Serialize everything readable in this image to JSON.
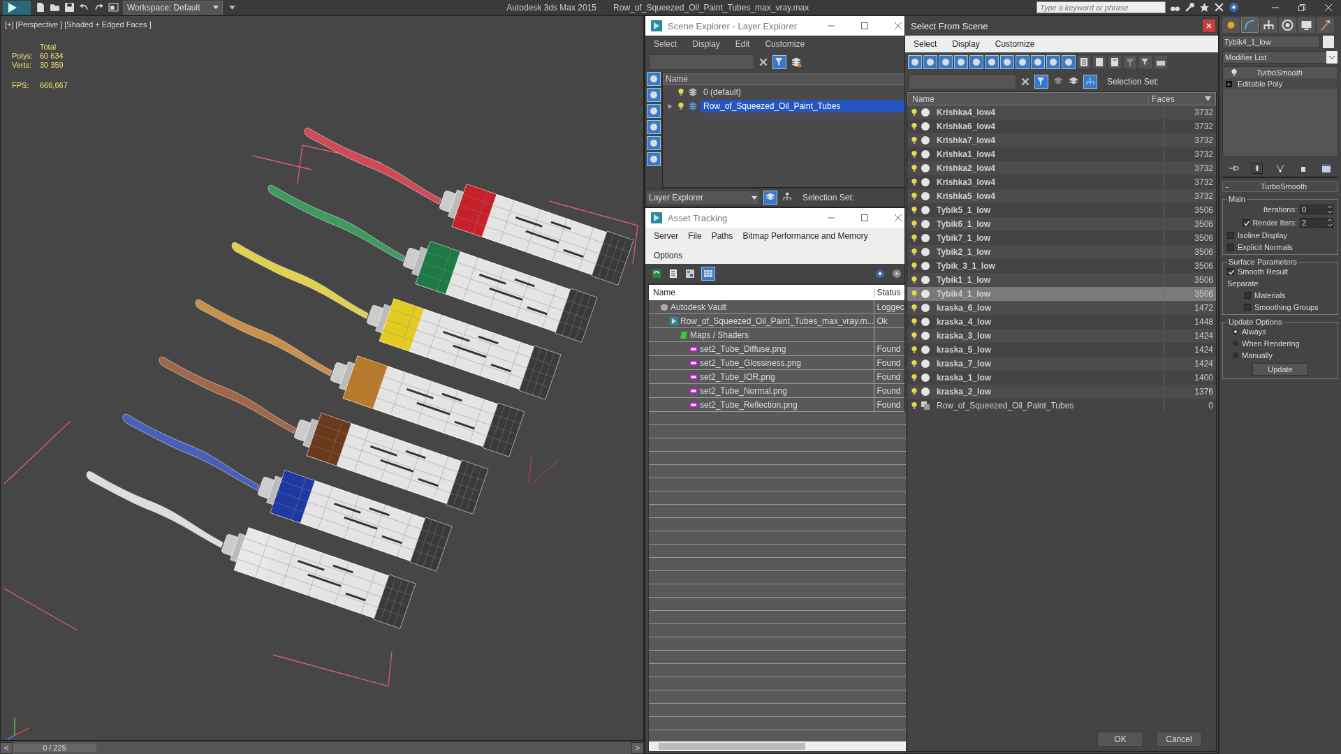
{
  "title_bar": {
    "workspace": "Workspace: Default",
    "app_title": "Autodesk 3ds Max  2015",
    "file_title": "Row_of_Squeezed_Oil_Paint_Tubes_max_vray.max",
    "search_placeholder": "Type a keyword or phrase"
  },
  "viewport": {
    "label": "[+] [Perspective ] [Shaded + Edged Faces ]",
    "stats_header": "Total",
    "stats": [
      {
        "label": "Polys:",
        "value": "60 634"
      },
      {
        "label": "Verts:",
        "value": "30 359"
      }
    ],
    "fps_label": "FPS:",
    "fps": "666,667"
  },
  "timeline": {
    "prev": "<",
    "position": "0 / 225",
    "level": 0,
    "next": ">"
  },
  "scene_explorer": {
    "title": "Scene Explorer - Layer Explorer",
    "menu": [
      "Select",
      "Display",
      "Edit",
      "Customize"
    ],
    "column": "Name",
    "layers": [
      {
        "name": "0 (default)",
        "selected": false,
        "expandable": false
      },
      {
        "name": "Row_of_Squeezed_Oil_Paint_Tubes",
        "selected": true,
        "expandable": true
      }
    ],
    "mode": "Layer Explorer",
    "selection_set_label": "Selection Set:"
  },
  "asset_tracking": {
    "title": "Asset Tracking",
    "menu": [
      "Server",
      "File",
      "Paths",
      "Bitmap Performance and Memory",
      "Options"
    ],
    "columns": [
      "Name",
      "Status"
    ],
    "tree": [
      {
        "kind": "vault",
        "name": "Autodesk Vault",
        "status": "Loggec",
        "children": [
          {
            "kind": "max",
            "name": "Row_of_Squeezed_Oil_Paint_Tubes_max_vray.m...",
            "status": "Ok",
            "children": [
              {
                "kind": "maps",
                "name": "Maps / Shaders",
                "children": [
                  {
                    "kind": "png",
                    "name": "set2_Tube_Diffuse.png",
                    "status": "Found"
                  },
                  {
                    "kind": "png",
                    "name": "set2_Tube_Glossiness.png",
                    "status": "Found"
                  },
                  {
                    "kind": "png",
                    "name": "set2_Tube_IOR.png",
                    "status": "Found"
                  },
                  {
                    "kind": "png",
                    "name": "set2_Tube_Normal.png",
                    "status": "Found"
                  },
                  {
                    "kind": "png",
                    "name": "set2_Tube_Reflection.png",
                    "status": "Found"
                  }
                ]
              }
            ]
          }
        ]
      }
    ]
  },
  "select_from_scene": {
    "title": "Select From Scene",
    "menu": [
      "Select",
      "Display",
      "Customize"
    ],
    "selection_set_label": "Selection Set:",
    "columns": [
      "Name",
      "Faces"
    ],
    "rows": [
      {
        "kind": "geometry",
        "name": "Krishka4_low4",
        "faces": "3732",
        "selected": false
      },
      {
        "kind": "geometry",
        "name": "Krishka6_low4",
        "faces": "3732",
        "selected": false
      },
      {
        "kind": "geometry",
        "name": "Krishka7_low4",
        "faces": "3732",
        "selected": false
      },
      {
        "kind": "geometry",
        "name": "Krishka1_low4",
        "faces": "3732",
        "selected": false
      },
      {
        "kind": "geometry",
        "name": "Krishka2_low4",
        "faces": "3732",
        "selected": false
      },
      {
        "kind": "geometry",
        "name": "Krishka3_low4",
        "faces": "3732",
        "selected": false
      },
      {
        "kind": "geometry",
        "name": "Krishka5_low4",
        "faces": "3732",
        "selected": false
      },
      {
        "kind": "geometry",
        "name": "Tybik5_1_low",
        "faces": "3506",
        "selected": false
      },
      {
        "kind": "geometry",
        "name": "Tybik6_1_low",
        "faces": "3506",
        "selected": false
      },
      {
        "kind": "geometry",
        "name": "Tybik7_1_low",
        "faces": "3506",
        "selected": false
      },
      {
        "kind": "geometry",
        "name": "Tybik2_1_low",
        "faces": "3506",
        "selected": false
      },
      {
        "kind": "geometry",
        "name": "Tybik_3_1_low",
        "faces": "3506",
        "selected": false
      },
      {
        "kind": "geometry",
        "name": "Tybik1_1_low",
        "faces": "3506",
        "selected": false
      },
      {
        "kind": "geometry",
        "name": "Tybik4_1_low",
        "faces": "3506",
        "selected": true
      },
      {
        "kind": "geometry",
        "name": "kraska_6_low",
        "faces": "1472",
        "selected": false
      },
      {
        "kind": "geometry",
        "name": "kraska_4_low",
        "faces": "1448",
        "selected": false
      },
      {
        "kind": "geometry",
        "name": "kraska_3_low",
        "faces": "1424",
        "selected": false
      },
      {
        "kind": "geometry",
        "name": "kraska_5_low",
        "faces": "1424",
        "selected": false
      },
      {
        "kind": "geometry",
        "name": "kraska_7_low",
        "faces": "1424",
        "selected": false
      },
      {
        "kind": "geometry",
        "name": "kraska_1_low",
        "faces": "1400",
        "selected": false
      },
      {
        "kind": "geometry",
        "name": "kraska_2_low",
        "faces": "1376",
        "selected": false
      },
      {
        "kind": "group",
        "name": "Row_of_Squeezed_Oil_Paint_Tubes",
        "faces": "0",
        "selected": false
      }
    ],
    "buttons": [
      "OK",
      "Cancel"
    ]
  },
  "command_panel": {
    "object_name": "Tybik4_1_low",
    "modifier_list": "Modifier List",
    "stack": [
      {
        "kind": "modifier",
        "name": "TurboSmooth"
      },
      {
        "kind": "base",
        "name": "Editable Poly"
      }
    ],
    "rollout": {
      "collapse": "-",
      "title": "TurboSmooth",
      "main": {
        "label": "Main",
        "iterations": {
          "label": "Iterations:",
          "value": "0"
        },
        "render_iters": {
          "label": "Render Iters:",
          "value": "2",
          "checked": true
        },
        "checkboxes": [
          {
            "label": "Isoline Display",
            "checked": false
          },
          {
            "label": "Explicit Normals",
            "checked": false
          }
        ]
      },
      "surface": {
        "label": "Surface Parameters",
        "smooth_result": {
          "label": "Smooth Result",
          "checked": true
        },
        "separate_label": "Separate",
        "checkboxes": [
          {
            "label": "Materials",
            "checked": false
          },
          {
            "label": "Smoothing Groups",
            "checked": false
          }
        ]
      },
      "update": {
        "label": "Update Options",
        "options": [
          {
            "label": "Always",
            "selected": true
          },
          {
            "label": "When Rendering",
            "selected": false
          },
          {
            "label": "Manually",
            "selected": false
          }
        ],
        "button": "Update"
      }
    }
  }
}
